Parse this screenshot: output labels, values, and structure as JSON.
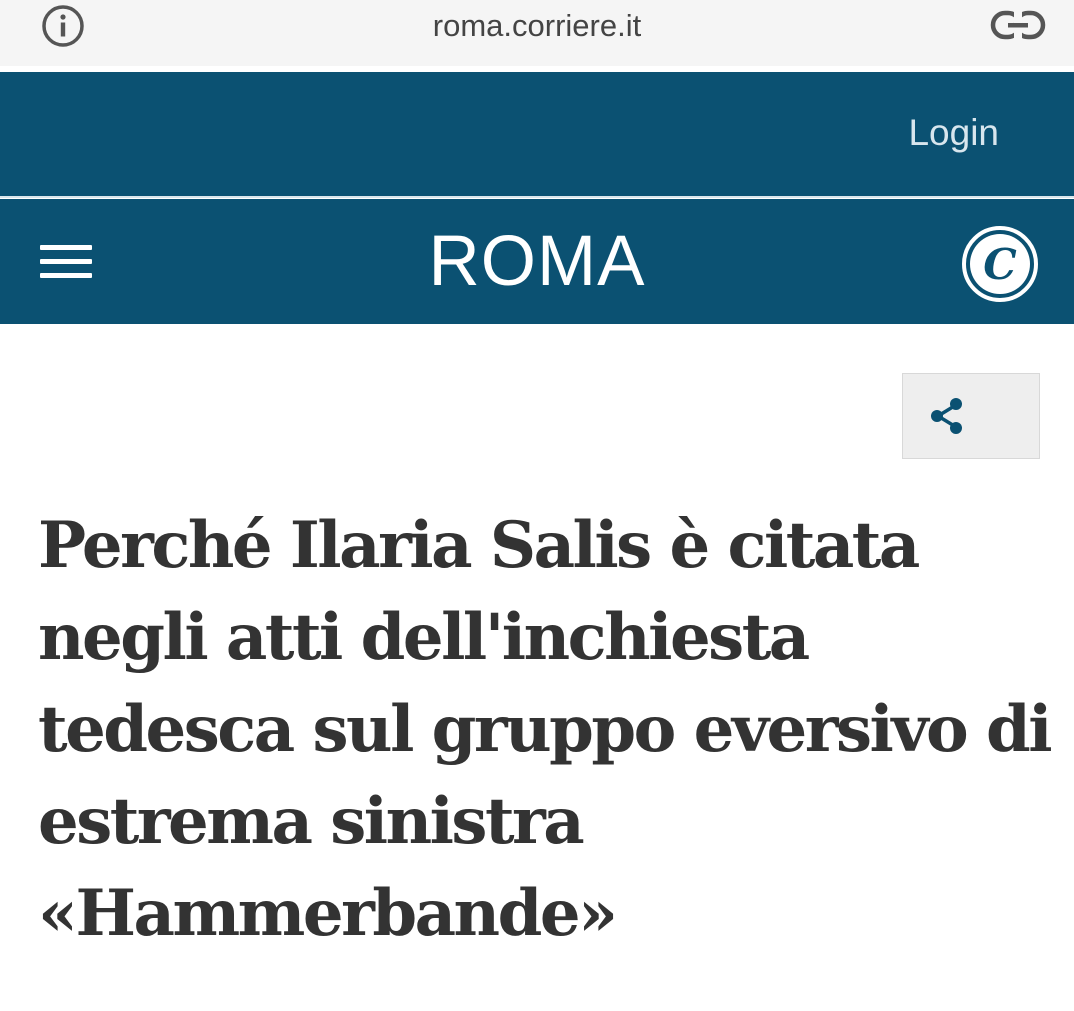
{
  "browser": {
    "url": "roma.corriere.it",
    "info_icon": "info-circle-icon",
    "link_icon": "link-icon"
  },
  "header": {
    "login_label": "Login",
    "section_title": "ROMA",
    "menu_icon": "hamburger-menu-icon",
    "logo_letter": "C"
  },
  "article": {
    "share_icon": "share-icon",
    "headline": "Perché Ilaria Salis è citata negli atti dell'inchiesta tedesca sul gruppo eversivo di estrema sinistra «Hammerbande»"
  },
  "colors": {
    "brand_blue": "#0b5172",
    "headline_text": "#333333",
    "url_bar_bg": "#f5f5f5"
  }
}
